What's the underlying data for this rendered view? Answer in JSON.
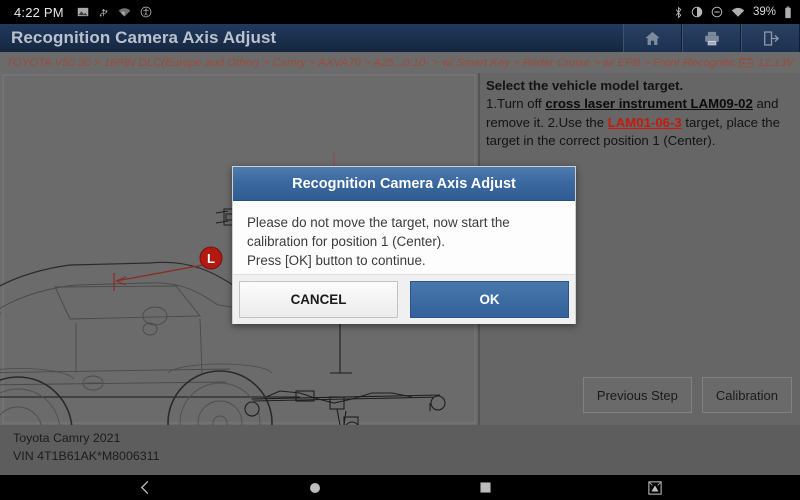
{
  "statusbar": {
    "clock": "4:22 PM",
    "left_icons": [
      "image-icon",
      "usb-icon",
      "wifi-weak-icon",
      "accessibility-icon"
    ],
    "right_icons": [
      "bluetooth-icon",
      "brightness-icon",
      "do-not-disturb-icon",
      "wifi-icon"
    ],
    "battery_percent": "39%"
  },
  "titlebar": {
    "title": "Recognition Camera Axis Adjust",
    "buttons": [
      {
        "name": "home-button",
        "icon": "home-icon"
      },
      {
        "name": "print-button",
        "icon": "printer-icon"
      },
      {
        "name": "exit-button",
        "icon": "exit-icon"
      }
    ]
  },
  "breadcrumb": {
    "path": "TOYOTA V50.30 > 16PIN DLC(Europe and Other) > Camry > AXVA70 > A25...0.10- > w/ Smart Key > Radar Cruise > w/ EPB > Front Recognition Camera",
    "battery_icon": "car-battery-icon",
    "voltage": "12.13V"
  },
  "instructions": {
    "heading": "Select the vehicle model target.",
    "step1_prefix": "1.Turn off ",
    "step1_link": "cross laser instrument LAM09-02",
    "step1_suffix": " and remove it.",
    "step2_prefix": "2.Use the ",
    "step2_link": "LAM01-06-3",
    "step2_suffix": " target, place the target in the correct position 1 (Center)."
  },
  "diagram": {
    "label_marker": "L",
    "alt": "vehicle side view with calibration target frame"
  },
  "step_buttons": {
    "previous": "Previous Step",
    "calibration": "Calibration"
  },
  "vehicle": {
    "model": "Toyota Camry 2021",
    "vin": "VIN 4T1B61AK*M8006311"
  },
  "dialog": {
    "title": "Recognition Camera Axis Adjust",
    "line1": "Please do not move the target, now start the calibration for position 1 (Center).",
    "line2": "Press [OK] button to continue.",
    "cancel_label": "CANCEL",
    "ok_label": "OK"
  },
  "navbar": {
    "items": [
      "back-icon",
      "home-icon",
      "recents-icon",
      "screenshot-icon"
    ]
  },
  "colors": {
    "titlebar": "#1b2f4d",
    "accent_blue": "#3b69a0",
    "breadcrumb_text": "#9c4b3a",
    "link_red": "#c41b0e",
    "panel_gray": "#6b6b6b"
  }
}
